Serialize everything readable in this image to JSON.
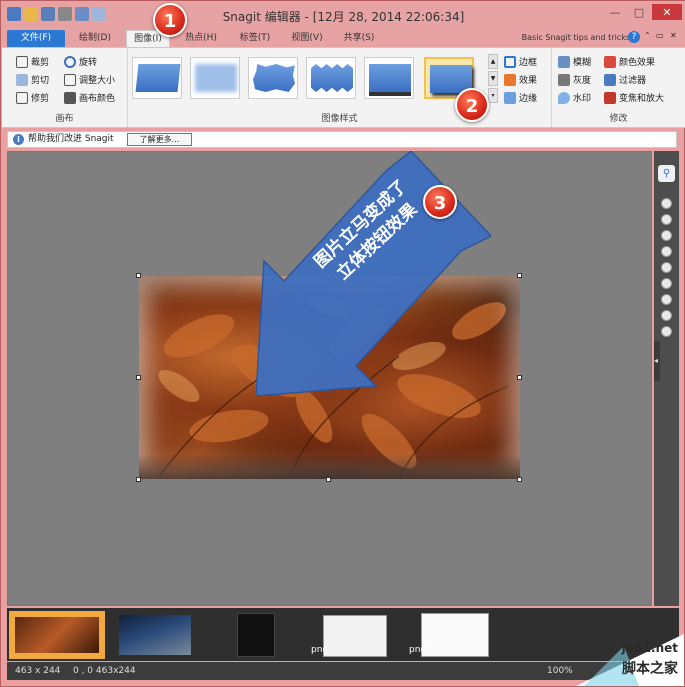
{
  "window": {
    "title": "Snagit 编辑器 - [12月 28, 2014 22:06:34]",
    "min": "—",
    "max": "□",
    "close": "✕"
  },
  "tabs": {
    "file": "文件(F)",
    "draw": "绘制(D)",
    "image": "图像(I)",
    "hotspot": "热点(H)",
    "tags": "标签(T)",
    "view": "视图(V)",
    "share": "共享(S)"
  },
  "tips": "Basic Snagit tips and tricks",
  "ribbon": {
    "canvas_group": {
      "label": "画布",
      "crop": "裁剪",
      "rotate": "旋转",
      "cut": "剪切",
      "resize": "调整大小",
      "trim": "修剪",
      "canvas_color": "画布颜色"
    },
    "styles_group": {
      "label": "图像样式",
      "border": "边框",
      "effects": "效果",
      "edges": "边缘"
    },
    "modify_group": {
      "label": "修改",
      "blur": "模糊",
      "color_effects": "颜色效果",
      "grayscale": "灰度",
      "filters": "过滤器",
      "watermark": "水印",
      "magnify": "变焦和放大"
    }
  },
  "infobar": {
    "message": "帮助我们改进 Snagit",
    "more": "了解更多..."
  },
  "callout": {
    "line1": "图片立马变成了",
    "line2": "立体按钮效果"
  },
  "badges": [
    "1",
    "2",
    "3"
  ],
  "tray": {
    "tag1": "png",
    "tag2": "png"
  },
  "status": {
    "size": "463 x 244",
    "coords": "0 , 0  463x244",
    "zoom": "100%"
  },
  "watermark": {
    "site": "jb51.net",
    "name": "脚本之家"
  },
  "colors": {
    "title_bg": "#e7a3a4",
    "file_tab": "#2b79d2",
    "canvas_bg": "#7f7f7f",
    "callout": "#3f6fc0",
    "badge": "#d7281a"
  }
}
